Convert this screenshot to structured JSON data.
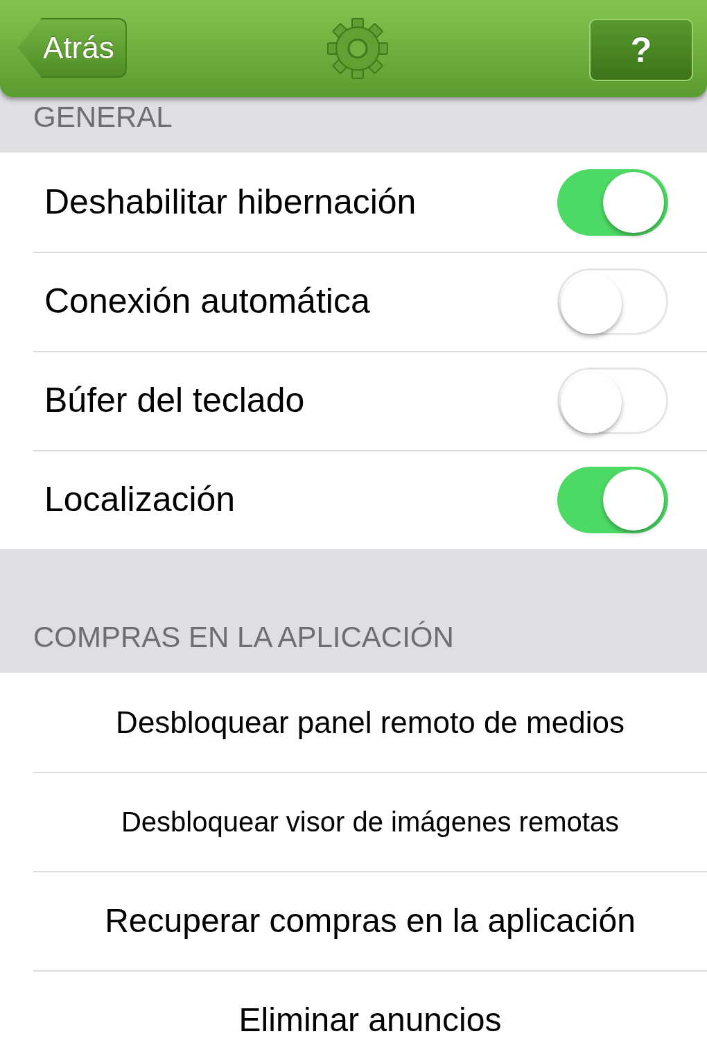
{
  "nav_bar": {
    "back_button": "Atrás",
    "help_button": "?"
  },
  "sections": [
    {
      "header": "GENERAL",
      "rows": [
        {
          "kind": "toggle",
          "label": "Deshabilitar hibernación",
          "on": true
        },
        {
          "kind": "toggle",
          "label": "Conexión automática",
          "on": false
        },
        {
          "kind": "toggle",
          "label": "Búfer del teclado",
          "on": false
        },
        {
          "kind": "toggle",
          "label": "Localización",
          "on": true
        }
      ]
    },
    {
      "header": "COMPRAS EN LA APLICACIÓN",
      "rows": [
        {
          "kind": "action",
          "label": "Desbloquear panel remoto de medios"
        },
        {
          "kind": "action",
          "label": "Desbloquear visor de imágenes remotas"
        },
        {
          "kind": "action",
          "label": "Recuperar compras en la aplicación"
        },
        {
          "kind": "action",
          "label": "Eliminar anuncios"
        }
      ]
    }
  ]
}
